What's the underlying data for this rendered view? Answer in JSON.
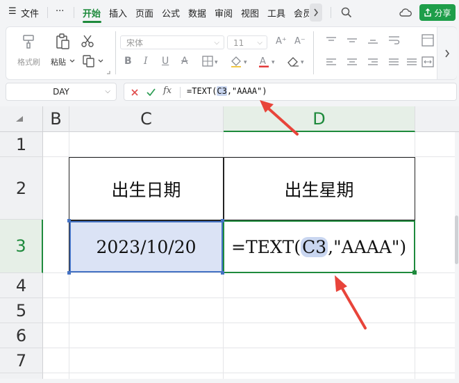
{
  "menu": {
    "hamburger": "☰",
    "file": "文件",
    "more": "···",
    "tabs": [
      "开始",
      "插入",
      "页面",
      "公式",
      "数据",
      "审阅",
      "视图",
      "工具",
      "会员"
    ],
    "share": "分享"
  },
  "ribbon": {
    "format_painter": "格式刷",
    "paste": "粘贴",
    "font_name": "宋体",
    "font_size": "11"
  },
  "formula_bar": {
    "name_box": "DAY",
    "formula_prefix": "=TEXT(",
    "formula_ref": "C3",
    "formula_suffix": ",\"AAAA\")"
  },
  "sheet": {
    "columns": [
      "B",
      "C",
      "D"
    ],
    "rows": [
      "1",
      "2",
      "3",
      "4",
      "5",
      "6",
      "7"
    ],
    "cells": {
      "C2": "出生日期",
      "D2": "出生星期",
      "C3": "2023/10/20",
      "D3_prefix": "=TEXT(",
      "D3_ref": "C3",
      "D3_suffix": ",\"AAAA\")"
    }
  },
  "colors": {
    "accent": "#1e8a3c",
    "share_button": "#1e9e4a",
    "selection_fill": "#dbe3f5",
    "arrow": "#e8443a"
  }
}
